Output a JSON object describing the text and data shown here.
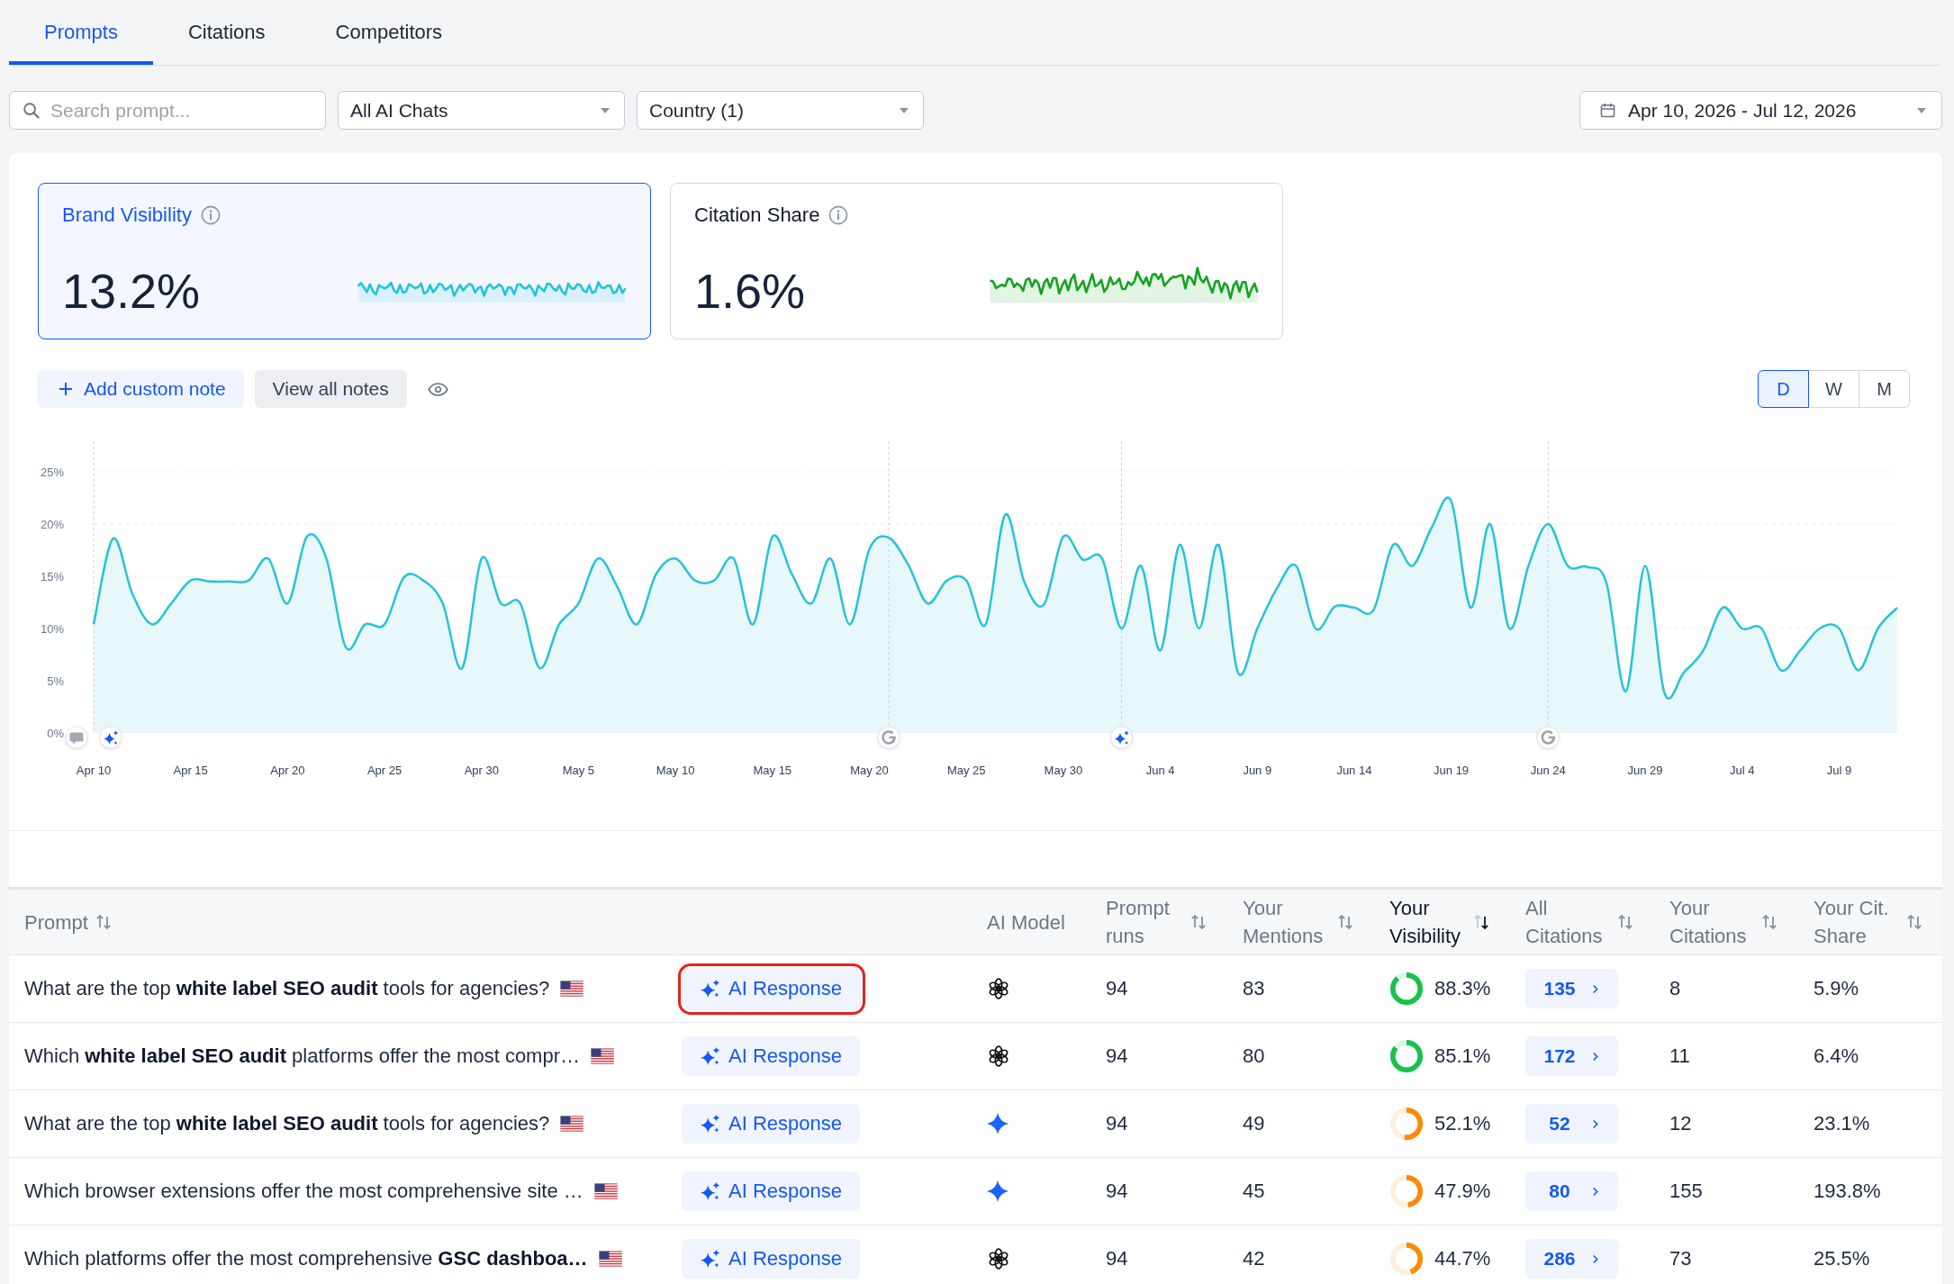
{
  "tabs": [
    {
      "label": "Prompts",
      "selected": true
    },
    {
      "label": "Citations",
      "selected": false
    },
    {
      "label": "Competitors",
      "selected": false
    }
  ],
  "filters": {
    "search": {
      "placeholder": "Search prompt..."
    },
    "dropdowns": [
      {
        "value": "All AI Chats"
      },
      {
        "value": "Country (1)"
      }
    ],
    "date_range": {
      "value": "Apr 10, 2026 - Jul 12, 2026"
    }
  },
  "metric_cards": [
    {
      "title": "Brand Visibility",
      "value": "13.2%",
      "selected": true,
      "color": "#22c4da"
    },
    {
      "title": "Citation Share",
      "value": "1.6%",
      "selected": false,
      "color": "#13a320"
    }
  ],
  "notes": {
    "add_button": "Add custom note",
    "view_button": "View all notes"
  },
  "granularity": [
    {
      "label": "D",
      "selected": true
    },
    {
      "label": "W",
      "selected": false
    },
    {
      "label": "M",
      "selected": false
    }
  ],
  "chart_data": {
    "type": "area",
    "grid": true,
    "ylim": [
      0,
      25
    ],
    "yticks": [
      {
        "value": 0,
        "label": "0%"
      },
      {
        "value": 5,
        "label": "5%"
      },
      {
        "value": 10,
        "label": "10%"
      },
      {
        "value": 15,
        "label": "15%"
      },
      {
        "value": 20,
        "label": "20%"
      },
      {
        "value": 25,
        "label": "25%"
      }
    ],
    "categories": [
      "Apr 10",
      null,
      null,
      null,
      null,
      "Apr 15",
      null,
      null,
      null,
      null,
      "Apr 20",
      null,
      null,
      null,
      null,
      "Apr 25",
      null,
      null,
      null,
      null,
      "Apr 30",
      null,
      null,
      null,
      null,
      "May 5",
      null,
      null,
      null,
      null,
      "May 10",
      null,
      null,
      null,
      null,
      "May 15",
      null,
      null,
      null,
      null,
      "May 20",
      null,
      null,
      null,
      null,
      "May 25",
      null,
      null,
      null,
      null,
      "May 30",
      null,
      null,
      null,
      null,
      "Jun 4",
      null,
      null,
      null,
      null,
      "Jun 9",
      null,
      null,
      null,
      null,
      "Jun 14",
      null,
      null,
      null,
      null,
      "Jun 19",
      null,
      null,
      null,
      null,
      "Jun 24",
      null,
      null,
      null,
      null,
      "Jun 29",
      null,
      null,
      null,
      null,
      "Jul 4",
      null,
      null,
      null,
      null,
      "Jul 9",
      null,
      null,
      null
    ],
    "values": [
      10.4,
      18.6,
      13.3,
      10.4,
      12.4,
      14.6,
      14.5,
      14.5,
      14.6,
      16.7,
      12.4,
      18.8,
      16.7,
      8.2,
      10.4,
      10.4,
      14.9,
      14.6,
      12.4,
      6.2,
      16.7,
      12.4,
      12.4,
      6.2,
      10.4,
      12.4,
      16.7,
      14.0,
      10.4,
      15.2,
      16.7,
      14.6,
      14.6,
      16.7,
      10.4,
      18.8,
      15.2,
      12.4,
      16.7,
      10.4,
      17.6,
      18.7,
      16.1,
      12.4,
      14.6,
      14.6,
      10.4,
      20.9,
      14.4,
      12.3,
      18.8,
      16.6,
      16.7,
      10.0,
      16.0,
      7.9,
      18.0,
      10.0,
      18.0,
      5.8,
      10.0,
      13.8,
      16.0,
      10.0,
      12.1,
      12.0,
      11.8,
      18.0,
      16.0,
      19.7,
      22.2,
      12.0,
      20.0,
      10.0,
      16.1,
      20.0,
      16.0,
      15.9,
      14.4,
      4.0,
      16.0,
      3.8,
      5.8,
      7.9,
      12.0,
      10.0,
      10.0,
      6.0,
      7.9,
      10.0,
      10.0,
      6.0,
      10.0,
      12.0
    ]
  },
  "chart_markers": [
    [
      {
        "kind": "note"
      },
      {
        "kind": "ai"
      }
    ],
    [
      {
        "kind": "google"
      }
    ],
    [
      {
        "kind": "ai"
      }
    ],
    [
      {
        "kind": "google"
      }
    ]
  ],
  "table": {
    "columns": [
      {
        "label": "Prompt",
        "sortable": true,
        "sorted": false
      },
      {
        "label": "AI Model",
        "sortable": false,
        "sorted": false
      },
      {
        "label": "Prompt runs",
        "sortable": true,
        "sorted": false
      },
      {
        "label": "Your Mentions",
        "sortable": true,
        "sorted": false
      },
      {
        "label": "Your Visibility",
        "sortable": true,
        "sorted": true
      },
      {
        "label": "All Citations",
        "sortable": true,
        "sorted": false
      },
      {
        "label": "Your Citations",
        "sortable": true,
        "sorted": false
      },
      {
        "label": "Your Cit. Share",
        "sortable": true,
        "sorted": false
      }
    ],
    "rows": [
      {
        "prompt": "What are the top **white label SEO audit** tools for agencies?",
        "ai_response": {
          "label": "AI Response",
          "highlighted": true
        },
        "ai_model": {
          "kind": "openai"
        },
        "prompt_runs": "94",
        "mentions": "83",
        "visibility": {
          "level": 0.883,
          "text": "88.3%",
          "color": "#17c24a"
        },
        "all_citations": "135",
        "your_citations": "8",
        "citation_share": "5.9%"
      },
      {
        "prompt": "Which **white label SEO audit** platforms offer the most compr…",
        "ai_response": {
          "label": "AI Response",
          "highlighted": false
        },
        "ai_model": {
          "kind": "openai"
        },
        "prompt_runs": "94",
        "mentions": "80",
        "visibility": {
          "level": 0.851,
          "text": "85.1%",
          "color": "#17c24a"
        },
        "all_citations": "172",
        "your_citations": "11",
        "citation_share": "6.4%"
      },
      {
        "prompt": "What are the top **white label SEO audit** tools for agencies?",
        "ai_response": {
          "label": "AI Response",
          "highlighted": false
        },
        "ai_model": {
          "kind": "gemini"
        },
        "prompt_runs": "94",
        "mentions": "49",
        "visibility": {
          "level": 0.521,
          "text": "52.1%",
          "color": "#fb8a00"
        },
        "all_citations": "52",
        "your_citations": "12",
        "citation_share": "23.1%"
      },
      {
        "prompt": "Which browser extensions offer the most comprehensive site …",
        "ai_response": {
          "label": "AI Response",
          "highlighted": false
        },
        "ai_model": {
          "kind": "gemini"
        },
        "prompt_runs": "94",
        "mentions": "45",
        "visibility": {
          "level": 0.479,
          "text": "47.9%",
          "color": "#fb8a00"
        },
        "all_citations": "80",
        "your_citations": "155",
        "citation_share": "193.8%"
      },
      {
        "prompt": "Which platforms offer the most comprehensive **GSC dashboa…**",
        "ai_response": {
          "label": "AI Response",
          "highlighted": false
        },
        "ai_model": {
          "kind": "openai"
        },
        "prompt_runs": "94",
        "mentions": "42",
        "visibility": {
          "level": 0.447,
          "text": "44.7%",
          "color": "#fb8a00"
        },
        "all_citations": "286",
        "your_citations": "73",
        "citation_share": "25.5%"
      }
    ]
  }
}
